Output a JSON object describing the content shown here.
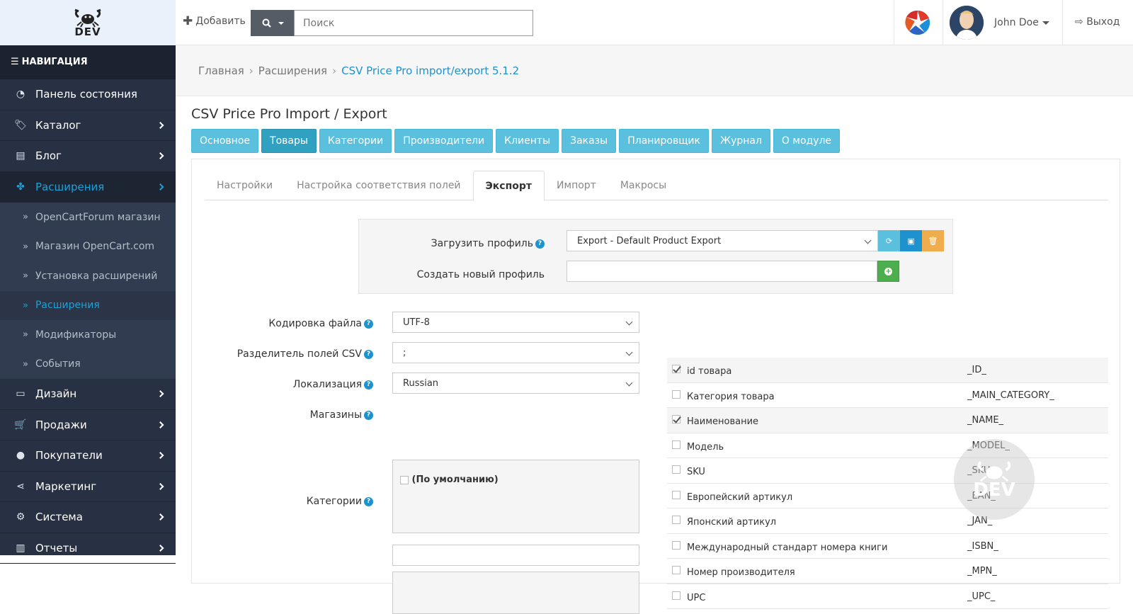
{
  "header": {
    "logo_text": "DEV",
    "add_label": "Добавить",
    "search_placeholder": "Поиск",
    "user_name": "John Doe",
    "logout_label": "Выход"
  },
  "sidebar": {
    "nav_heading": "НАВИГАЦИЯ",
    "items": [
      {
        "label": "Панель состояния",
        "icon": "dashboard-icon"
      },
      {
        "label": "Каталог",
        "icon": "tags-icon"
      },
      {
        "label": "Блог",
        "icon": "book-icon"
      },
      {
        "label": "Расширения",
        "icon": "puzzle-icon"
      },
      {
        "label": "Дизайн",
        "icon": "desktop-icon"
      },
      {
        "label": "Продажи",
        "icon": "cart-icon"
      },
      {
        "label": "Покупатели",
        "icon": "user-icon"
      },
      {
        "label": "Маркетинг",
        "icon": "share-icon"
      },
      {
        "label": "Система",
        "icon": "cog-icon"
      },
      {
        "label": "Отчеты",
        "icon": "bar-chart-icon"
      }
    ],
    "sub_items": [
      {
        "label": "OpenCartForum магазин"
      },
      {
        "label": "Магазин OpenCart.com"
      },
      {
        "label": "Установка расширений"
      },
      {
        "label": "Расширения"
      },
      {
        "label": "Модификаторы"
      },
      {
        "label": "События"
      }
    ],
    "active_color": "#1ea0d6"
  },
  "breadcrumb": {
    "items": [
      "Главная",
      "Расширения",
      "CSV Price Pro import/export 5.1.2"
    ]
  },
  "page": {
    "title": "CSV Price Pro Import / Export",
    "top_tabs": [
      "Основное",
      "Товары",
      "Категории",
      "Производители",
      "Клиенты",
      "Заказы",
      "Планировщик",
      "Журнал",
      "О модуле"
    ],
    "sub_tabs": [
      "Настройки",
      "Настройка соответствия полей",
      "Экспорт",
      "Импорт",
      "Макросы"
    ]
  },
  "profile": {
    "load_label": "Загрузить профиль",
    "load_value": "Export - Default Product Export",
    "create_label": "Создать новый профиль",
    "create_value": ""
  },
  "settings": {
    "encoding_label": "Кодировка файла",
    "encoding_value": "UTF-8",
    "delimiter_label": "Разделитель полей CSV",
    "delimiter_value": ";",
    "locale_label": "Локализация",
    "locale_value": "Russian",
    "stores_label": "Магазины",
    "store_default": "(По умолчанию)",
    "categories_label": "Категории"
  },
  "fields": [
    {
      "name": "id товара",
      "key": "_ID_",
      "checked": true
    },
    {
      "name": "Категория товара",
      "key": "_MAIN_CATEGORY_",
      "checked": false
    },
    {
      "name": "Наименование",
      "key": "_NAME_",
      "checked": true
    },
    {
      "name": "Модель",
      "key": "_MODEL_",
      "checked": false
    },
    {
      "name": "SKU",
      "key": "_SKU_",
      "checked": false
    },
    {
      "name": "Европейский артикул",
      "key": "_EAN_",
      "checked": false
    },
    {
      "name": "Японский артикул",
      "key": "_JAN_",
      "checked": false
    },
    {
      "name": "Международный стандарт номера книги",
      "key": "_ISBN_",
      "checked": false
    },
    {
      "name": "Номер производителя",
      "key": "_MPN_",
      "checked": false
    },
    {
      "name": "UPC",
      "key": "_UPC_",
      "checked": false
    }
  ],
  "colors": {
    "info": "#5bc0de",
    "primary": "#1e91cf",
    "warning": "#f0ad4e",
    "success": "#4cae4c"
  }
}
